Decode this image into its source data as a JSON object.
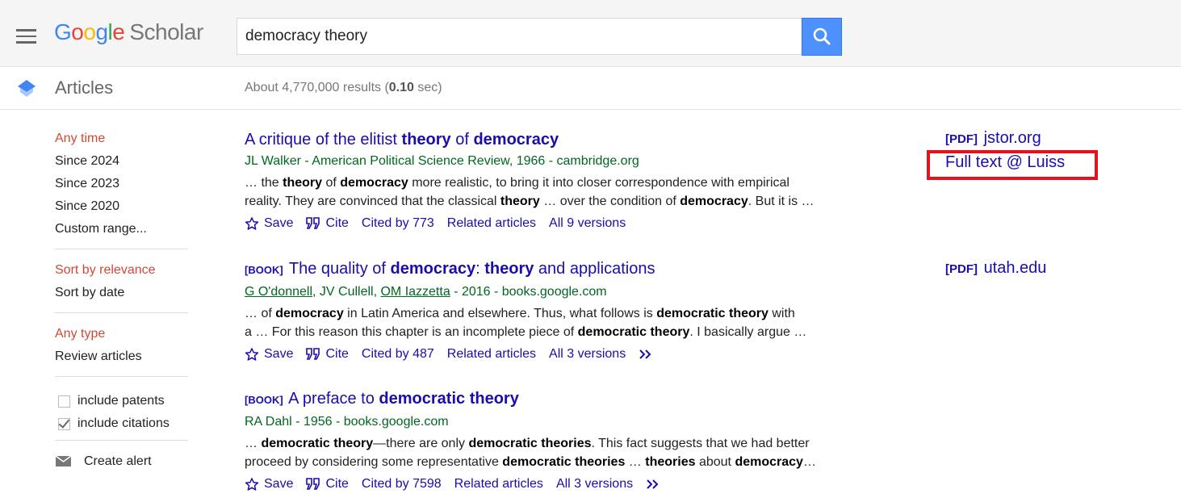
{
  "header": {
    "logo_google": [
      "G",
      "o",
      "o",
      "g",
      "l",
      "e"
    ],
    "logo_scholar": "Scholar",
    "search_value": "democracy theory"
  },
  "subheader": {
    "section": "Articles",
    "results_prefix": "About 4,770,000 results (",
    "results_time": "0.10",
    "results_suffix": " sec)"
  },
  "sidebar": {
    "time_filters": [
      "Any time",
      "Since 2024",
      "Since 2023",
      "Since 2020",
      "Custom range..."
    ],
    "sort_options": [
      "Sort by relevance",
      "Sort by date"
    ],
    "type_options": [
      "Any type",
      "Review articles"
    ],
    "include_patents": "include patents",
    "include_citations": "include citations",
    "create_alert": "Create alert"
  },
  "results": [
    {
      "title_parts": [
        "A critique of the elitist ",
        "theory",
        " of ",
        "democracy"
      ],
      "authors": "JL Walker - American Political Science Review, 1966 - cambridge.org",
      "snippet_line1": [
        "… the ",
        "theory",
        " of ",
        "democracy",
        " more realistic, to bring it into closer correspondence with empirical"
      ],
      "snippet_line2": [
        "reality. They are convinced that the classical ",
        "theory",
        " … over the condition of ",
        "democracy",
        ". But it is …"
      ],
      "save": "Save",
      "cite": "Cite",
      "cited_by": "Cited by 773",
      "related": "Related articles",
      "versions": "All 9 versions",
      "side_tag": "[PDF]",
      "side_source": "jstor.org",
      "side_fulltext": "Full text @ Luiss"
    },
    {
      "tag": "[BOOK]",
      "title_parts": [
        " The quality of ",
        "democracy",
        ": ",
        "theory",
        " and applications"
      ],
      "author_a": "G O'donnell",
      "author_b": ", JV Cullell, ",
      "author_c": "OM Iazzetta",
      "author_d": " - 2016 - books.google.com",
      "snippet_line1": [
        "… of ",
        "democracy",
        " in Latin America and elsewhere. Thus, what follows is ",
        "democratic theory",
        " with"
      ],
      "snippet_line2": [
        "a … For this reason this chapter is an incomplete piece of ",
        "democratic theory",
        ". I basically argue …"
      ],
      "save": "Save",
      "cite": "Cite",
      "cited_by": "Cited by 487",
      "related": "Related articles",
      "versions": "All 3 versions",
      "side_tag": "[PDF]",
      "side_source": "utah.edu"
    },
    {
      "tag": "[BOOK]",
      "title_parts": [
        " A preface to ",
        "democratic theory"
      ],
      "authors": "RA Dahl - 1956 - books.google.com",
      "snippet_line1": [
        "… ",
        "democratic theory",
        "—there are only ",
        "democratic theories",
        ". This fact suggests that we had better"
      ],
      "snippet_line2": [
        "proceed by considering some representative ",
        "democratic theories",
        " … ",
        "theories",
        " about ",
        "democracy",
        "…"
      ],
      "save": "Save",
      "cite": "Cite",
      "cited_by": "Cited by 7598",
      "related": "Related articles",
      "versions": "All 3 versions"
    }
  ],
  "colors": {
    "link": "#1a0dab",
    "author_green": "#006621",
    "selected_red": "#d14836",
    "highlight_red": "#e8101a",
    "search_button": "#4d90fe"
  }
}
